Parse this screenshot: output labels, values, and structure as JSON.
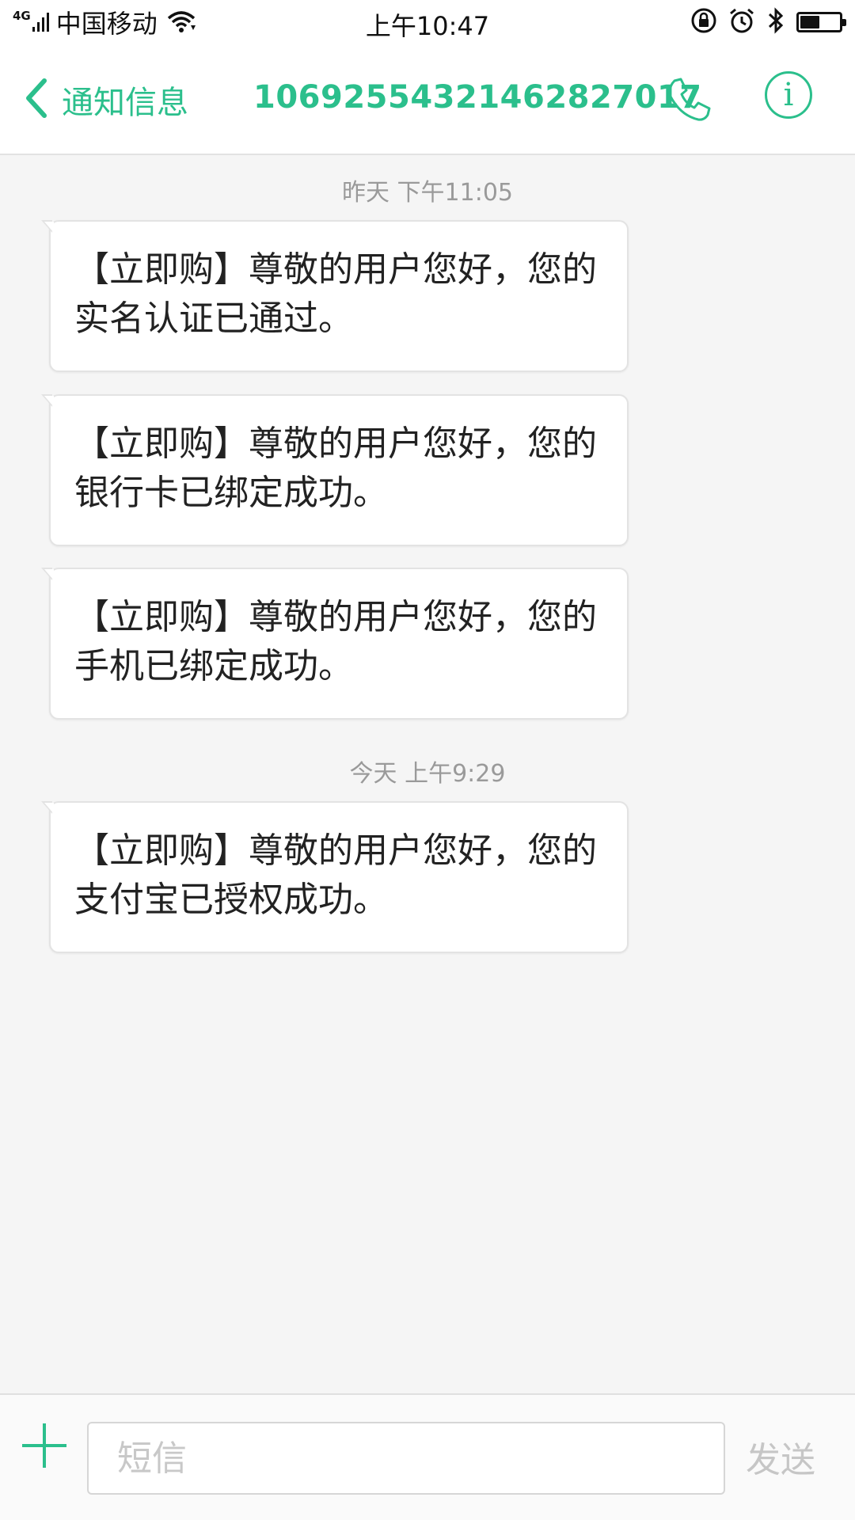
{
  "status_bar": {
    "network_type": "4G",
    "carrier": "中国移动",
    "time": "上午10:47",
    "battery_level": 0.5
  },
  "header": {
    "back_label": "通知信息",
    "title": "1069255432146282701​7",
    "icons": [
      "chevron-left-icon",
      "phone-icon",
      "info-icon"
    ],
    "info_glyph": "i",
    "accent_color": "#2bbf8c"
  },
  "messages": {
    "timestamp_1": "昨天 下午11:05",
    "msg_1": "【立即购】尊敬的用户您好，您的实名认证已通过。",
    "msg_2": "【立即购】尊敬的用户您好，您的银行卡已绑定成功。",
    "msg_3": "【立即购】尊敬的用户您好，您的手机已绑定成功。",
    "timestamp_2": "今天 上午9:29",
    "msg_4": "【立即购】尊敬的用户您好，您的支付宝已授权成功。"
  },
  "input_bar": {
    "placeholder": "短信",
    "value": "",
    "send_label": "发送"
  }
}
